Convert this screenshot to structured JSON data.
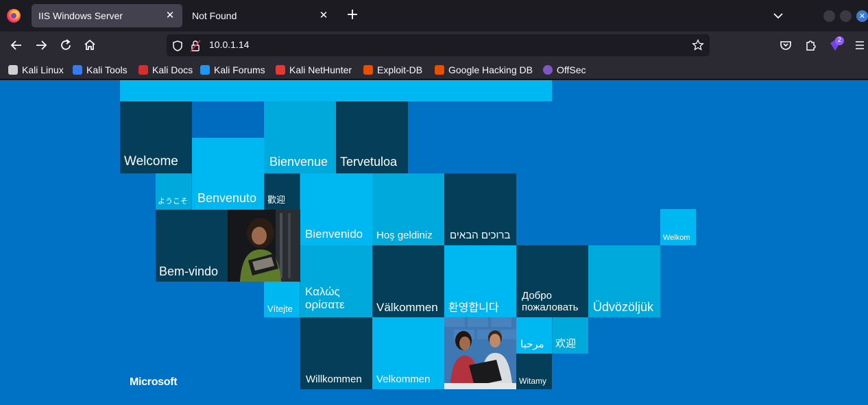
{
  "browser": {
    "tabs": [
      {
        "title": "IIS Windows Server",
        "active": true
      },
      {
        "title": "Not Found",
        "active": false
      }
    ],
    "url": "10.0.1.14",
    "extension_badge": "2",
    "bookmarks": [
      {
        "label": "Kali Linux",
        "icon": "kali-dragon-icon",
        "color": "#cfcfcf"
      },
      {
        "label": "Kali Tools",
        "icon": "kali-tools-icon",
        "color": "#367bf0"
      },
      {
        "label": "Kali Docs",
        "icon": "kali-docs-icon",
        "color": "#d32f2f"
      },
      {
        "label": "Kali Forums",
        "icon": "kali-forums-icon",
        "color": "#2196f3"
      },
      {
        "label": "Kali NetHunter",
        "icon": "kali-nethunter-icon",
        "color": "#e53935"
      },
      {
        "label": "Exploit-DB",
        "icon": "exploit-db-icon",
        "color": "#e65100"
      },
      {
        "label": "Google Hacking DB",
        "icon": "ghdb-icon",
        "color": "#e65100"
      },
      {
        "label": "OffSec",
        "icon": "offsec-icon",
        "color": "#7e57c2"
      }
    ]
  },
  "iis": {
    "background_color": "#0072c6",
    "brand": "Microsoft",
    "tiles": {
      "welcome": "Welcome",
      "bienvenue": "Bienvenue",
      "tervetuloa": "Tervetuloa",
      "youkoso": "ようこそ",
      "benvenuto": "Benvenuto",
      "huanying_trad": "歡迎",
      "bienvenido": "Bienvenido",
      "hos_geldiniz": "Hoş geldiniz",
      "hebrew": "ברוכים הבאים",
      "welkom": "Welkom",
      "bem_vindo": "Bem-vindo",
      "vitejte": "Vítejte",
      "greek_1": "Καλώς",
      "greek_2": "ορίσατε",
      "valkommen": "Välkommen",
      "korean": "환영합니다",
      "russian_1": "Добро",
      "russian_2": "пожаловать",
      "udvozoljuk": "Üdvözöljük",
      "arabic": "مرحبا",
      "huanying_simp": "欢迎",
      "willkommen": "Willkommen",
      "velkommen": "Velkommen",
      "witamy": "Witamy"
    }
  }
}
